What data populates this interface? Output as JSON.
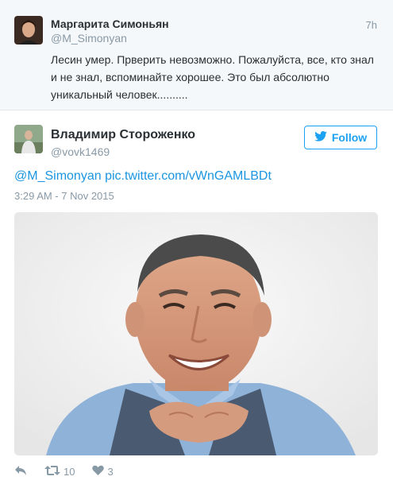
{
  "quoted_tweet": {
    "name": "Маргарита Симоньян",
    "handle": "@M_Simonyan",
    "time": "7h",
    "text": "Лесин умер. Прверить невозможно. Пожалуйста, все, кто знал и не знал, вспоминайте хорошее. Это был абсолютно уникальный человек.........."
  },
  "tweet": {
    "name": "Владимир Стороженко",
    "handle": "@vovk1469",
    "follow_label": "Follow",
    "mention": "@M_Simonyan",
    "link": "pic.twitter.com/vWnGAMLBDt",
    "timestamp": "3:29 AM - 7 Nov 2015",
    "retweets": "10",
    "likes": "3"
  },
  "icons": {
    "reply": "reply-icon",
    "retweet": "retweet-icon",
    "like": "heart-icon",
    "bird": "twitter-bird-icon"
  },
  "colors": {
    "accent": "#1da1f2",
    "muted": "#8899a6",
    "text": "#292f33",
    "quoted_bg": "#f5f8fa"
  }
}
